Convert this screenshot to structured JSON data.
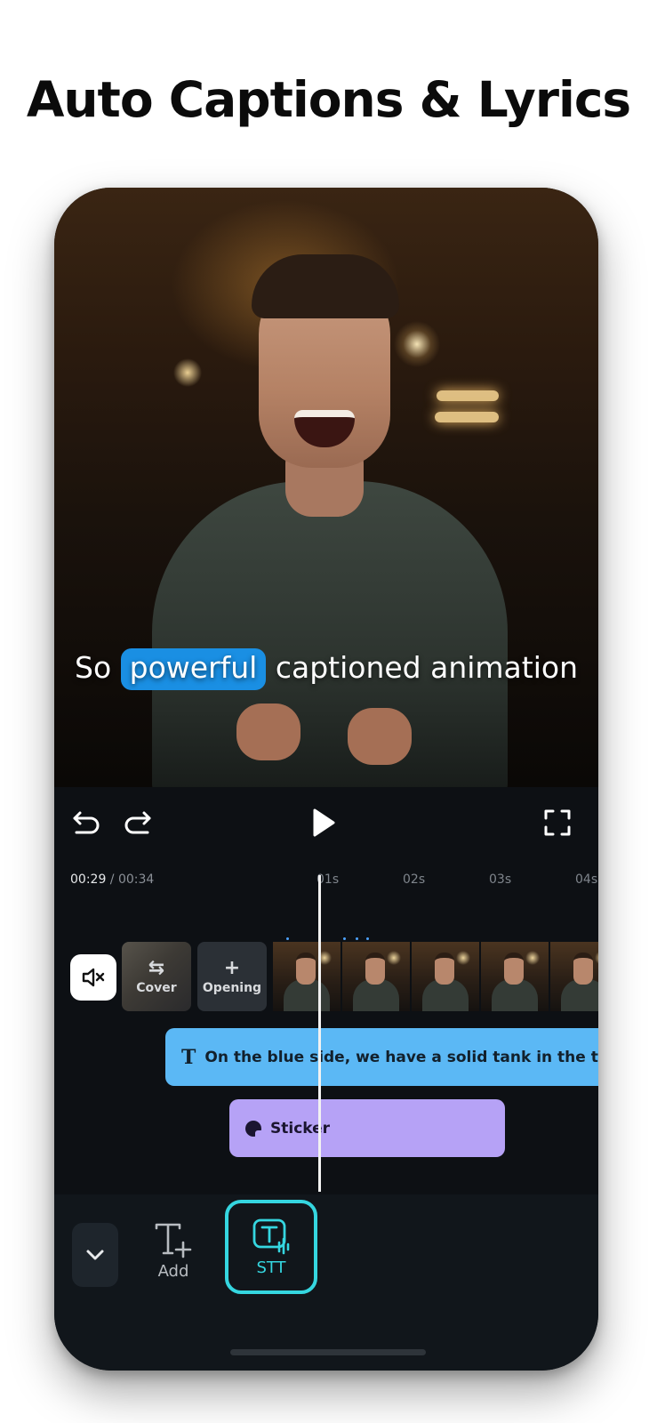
{
  "headline": "Auto Captions & Lyrics",
  "video": {
    "caption_before": "So ",
    "caption_highlight": "powerful",
    "caption_after": " captioned animation",
    "highlight_color": "#1a8fe3"
  },
  "controls": {
    "icons": [
      "undo-icon",
      "redo-icon",
      "play-icon",
      "fullscreen-icon"
    ]
  },
  "timeline": {
    "current_time": "00:29",
    "total_time": " / 00:34",
    "ticks": [
      "01s",
      "02s",
      "03s",
      "04s"
    ],
    "cover_label": "Cover",
    "opening_label": "Opening",
    "opening_symbol": "+",
    "text_clip_label": "On the blue side,  we have a solid tank in the top",
    "text_clip_color": "#5bb8f5",
    "sticker_clip_label": "Sticker",
    "sticker_clip_color": "#b6a2f6"
  },
  "toolbar": {
    "add_label": "Add",
    "stt_label": "STT",
    "active_color": "#35d6e0"
  }
}
